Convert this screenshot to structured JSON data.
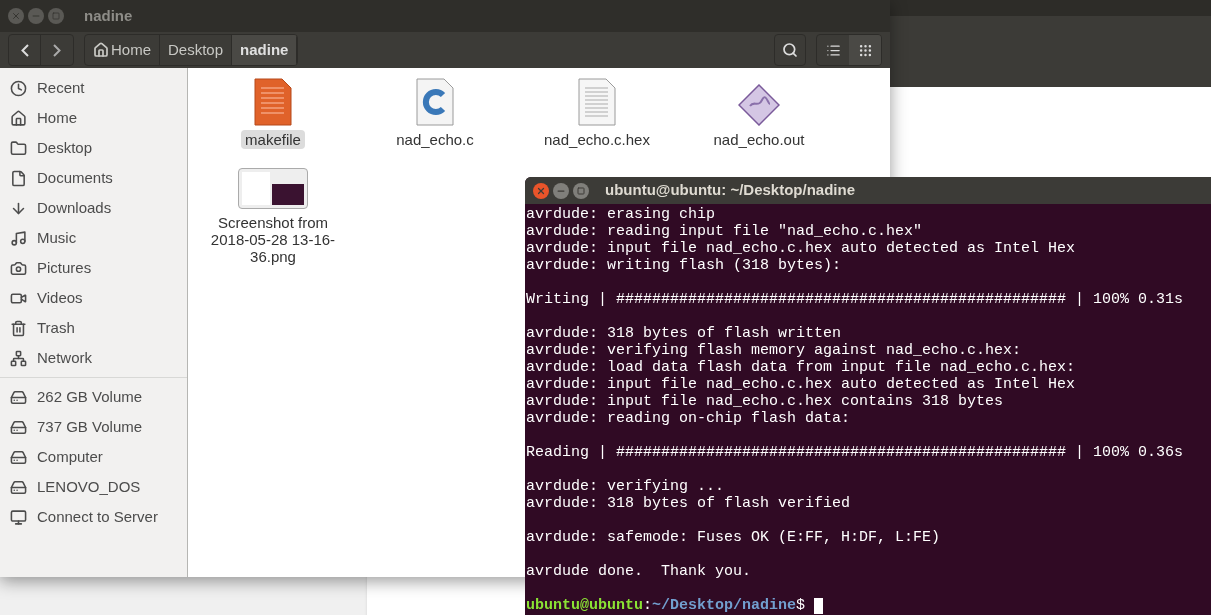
{
  "files_window": {
    "title": "nadine",
    "breadcrumbs": [
      {
        "label": "Home",
        "kind": "home",
        "selected": false
      },
      {
        "label": "Desktop",
        "kind": "folder",
        "selected": false
      },
      {
        "label": "nadine",
        "kind": "folder",
        "selected": true
      }
    ],
    "view_buttons": [
      {
        "kind": "list",
        "selected": false
      },
      {
        "kind": "grid",
        "selected": true
      }
    ],
    "places": [
      {
        "label": "Recent",
        "kind": "recent"
      },
      {
        "label": "Home",
        "kind": "home"
      },
      {
        "label": "Desktop",
        "kind": "desktop"
      },
      {
        "label": "Documents",
        "kind": "documents"
      },
      {
        "label": "Downloads",
        "kind": "downloads"
      },
      {
        "label": "Music",
        "kind": "music"
      },
      {
        "label": "Pictures",
        "kind": "pictures"
      },
      {
        "label": "Videos",
        "kind": "videos"
      },
      {
        "label": "Trash",
        "kind": "trash"
      },
      {
        "label": "Network",
        "kind": "network"
      }
    ],
    "devices": [
      {
        "label": "262 GB Volume",
        "kind": "drive"
      },
      {
        "label": "737 GB Volume",
        "kind": "drive"
      },
      {
        "label": "Computer",
        "kind": "drive"
      },
      {
        "label": "LENOVO_DOS",
        "kind": "drive"
      },
      {
        "label": "Connect to Server",
        "kind": "server"
      }
    ],
    "files": [
      {
        "name": "makefile",
        "kind": "text",
        "selected": true
      },
      {
        "name": "nad_echo.c",
        "kind": "c",
        "selected": false
      },
      {
        "name": "nad_echo.c.hex",
        "kind": "plain",
        "selected": false
      },
      {
        "name": "nad_echo.out",
        "kind": "binary",
        "selected": false
      },
      {
        "name": "Screenshot from 2018-05-28 13-16-36.png",
        "kind": "image",
        "selected": false
      }
    ]
  },
  "terminal": {
    "title": "ubuntu@ubuntu: ~/Desktop/nadine",
    "blocks": [
      [
        "avrdude: erasing chip",
        "avrdude: reading input file \"nad_echo.c.hex\"",
        "avrdude: input file nad_echo.c.hex auto detected as Intel Hex",
        "avrdude: writing flash (318 bytes):"
      ],
      [
        "Writing | ################################################## | 100% 0.31s"
      ],
      [
        "avrdude: 318 bytes of flash written",
        "avrdude: verifying flash memory against nad_echo.c.hex:",
        "avrdude: load data flash data from input file nad_echo.c.hex:",
        "avrdude: input file nad_echo.c.hex auto detected as Intel Hex",
        "avrdude: input file nad_echo.c.hex contains 318 bytes",
        "avrdude: reading on-chip flash data:"
      ],
      [
        "Reading | ################################################## | 100% 0.36s"
      ],
      [
        "avrdude: verifying ...",
        "avrdude: 318 bytes of flash verified"
      ],
      [
        "avrdude: safemode: Fuses OK (E:FF, H:DF, L:FE)"
      ],
      [
        "avrdude done.  Thank you."
      ]
    ],
    "prompt": {
      "user": "ubuntu@ubuntu",
      "separator": ":",
      "path": "~/Desktop/nadine",
      "symbol": "$"
    }
  }
}
